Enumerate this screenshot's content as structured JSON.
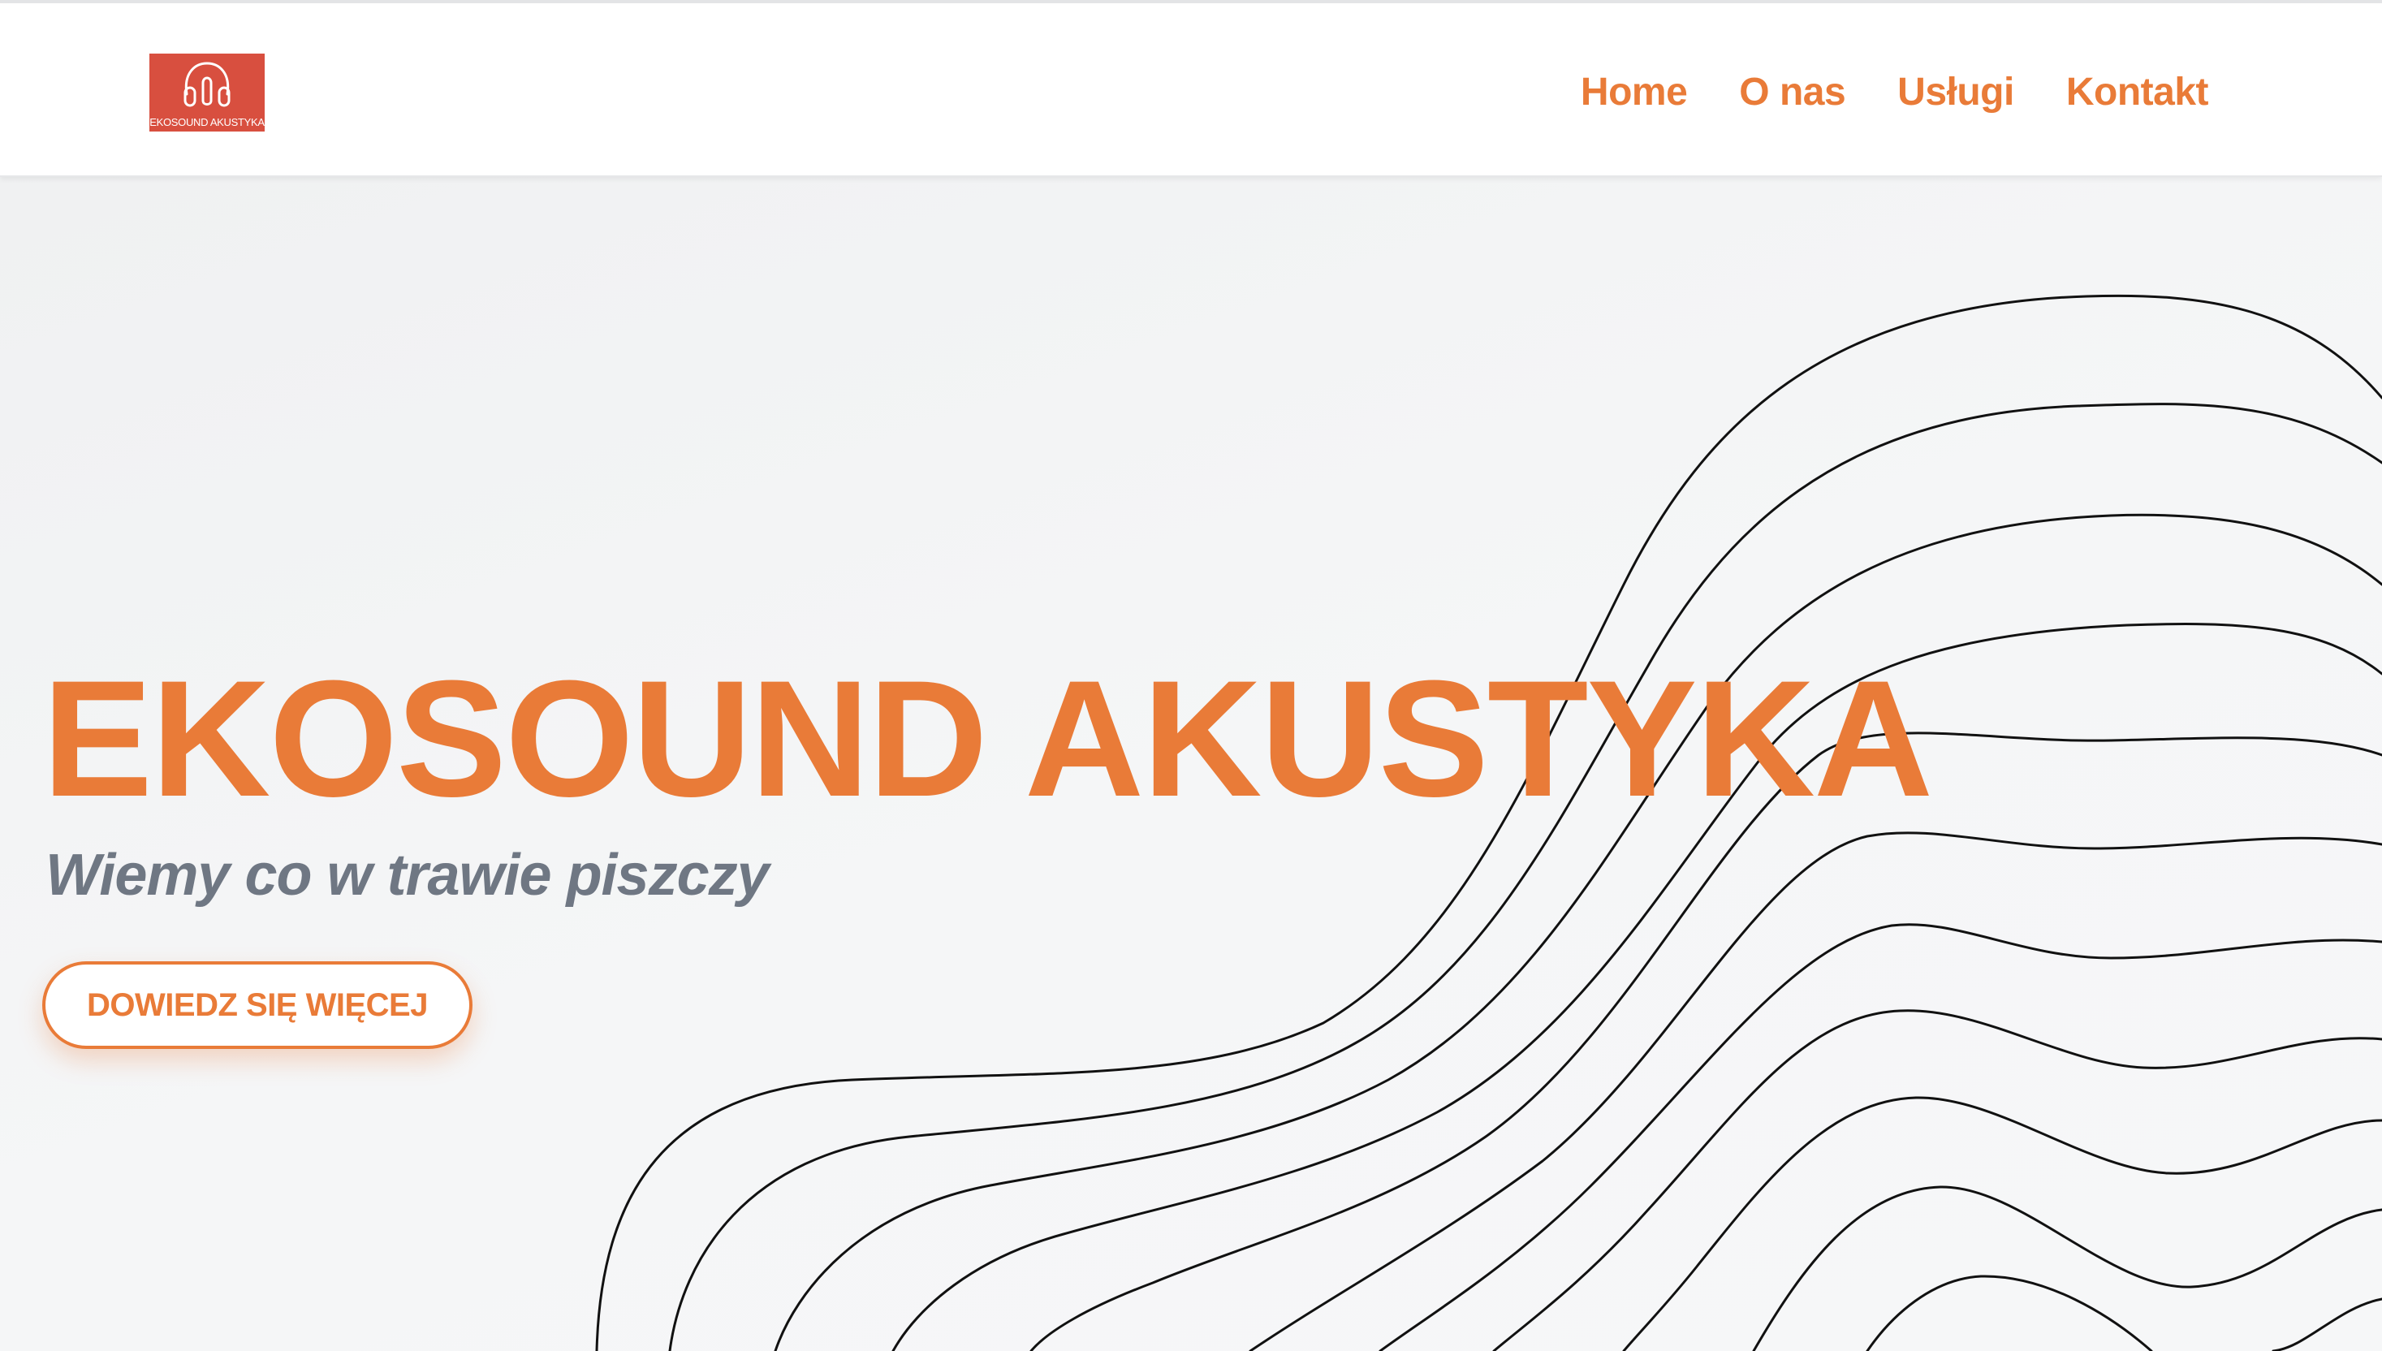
{
  "header": {
    "logo": {
      "text": "EKOSOUND AKUSTYKA",
      "icon": "headphones-icon",
      "background_color": "#d84f3f"
    },
    "nav": [
      {
        "label": "Home"
      },
      {
        "label": "O nas"
      },
      {
        "label": "Usługi"
      },
      {
        "label": "Kontakt"
      }
    ]
  },
  "hero": {
    "title": "EKOSOUND AKUSTYKA",
    "subtitle": "Wiemy co w trawie piszczy",
    "cta_label": "DOWIEDZ SIĘ WIĘCEJ"
  },
  "colors": {
    "accent": "#e97b38",
    "subtitle": "#6f7783",
    "background": "#f3f4f5",
    "wave_lines": "#111111"
  }
}
